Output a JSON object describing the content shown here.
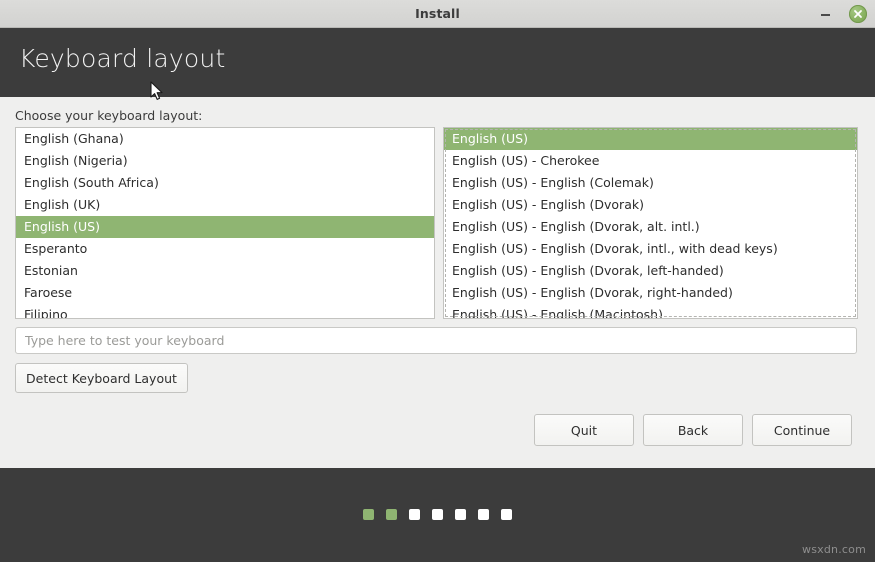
{
  "window": {
    "title": "Install",
    "minimize_icon": "minimize-icon",
    "close_icon": "close-icon"
  },
  "header": {
    "title": "Keyboard layout"
  },
  "main": {
    "prompt": "Choose your keyboard layout:",
    "layout_list": {
      "selected": "English (US)",
      "items": [
        "English (Ghana)",
        "English (Nigeria)",
        "English (South Africa)",
        "English (UK)",
        "English (US)",
        "Esperanto",
        "Estonian",
        "Faroese",
        "Filipino"
      ]
    },
    "variant_list": {
      "selected": "English (US)",
      "items": [
        "English (US)",
        "English (US) - Cherokee",
        "English (US) - English (Colemak)",
        "English (US) - English (Dvorak)",
        "English (US) - English (Dvorak, alt. intl.)",
        "English (US) - English (Dvorak, intl., with dead keys)",
        "English (US) - English (Dvorak, left-handed)",
        "English (US) - English (Dvorak, right-handed)",
        "English (US) - English (Macintosh)"
      ]
    },
    "test_input": {
      "value": "",
      "placeholder": "Type here to test your keyboard"
    },
    "detect_button": "Detect Keyboard Layout"
  },
  "actions": {
    "quit": "Quit",
    "back": "Back",
    "continue": "Continue"
  },
  "footer": {
    "steps_total": 7,
    "steps_completed": 2,
    "watermark": "wsxdn.com"
  },
  "colors": {
    "accent_green": "#8fb572",
    "header_dark": "#3c3c3c",
    "panel_bg": "#efefee",
    "titlebar_bg": "#d6d6d4"
  }
}
